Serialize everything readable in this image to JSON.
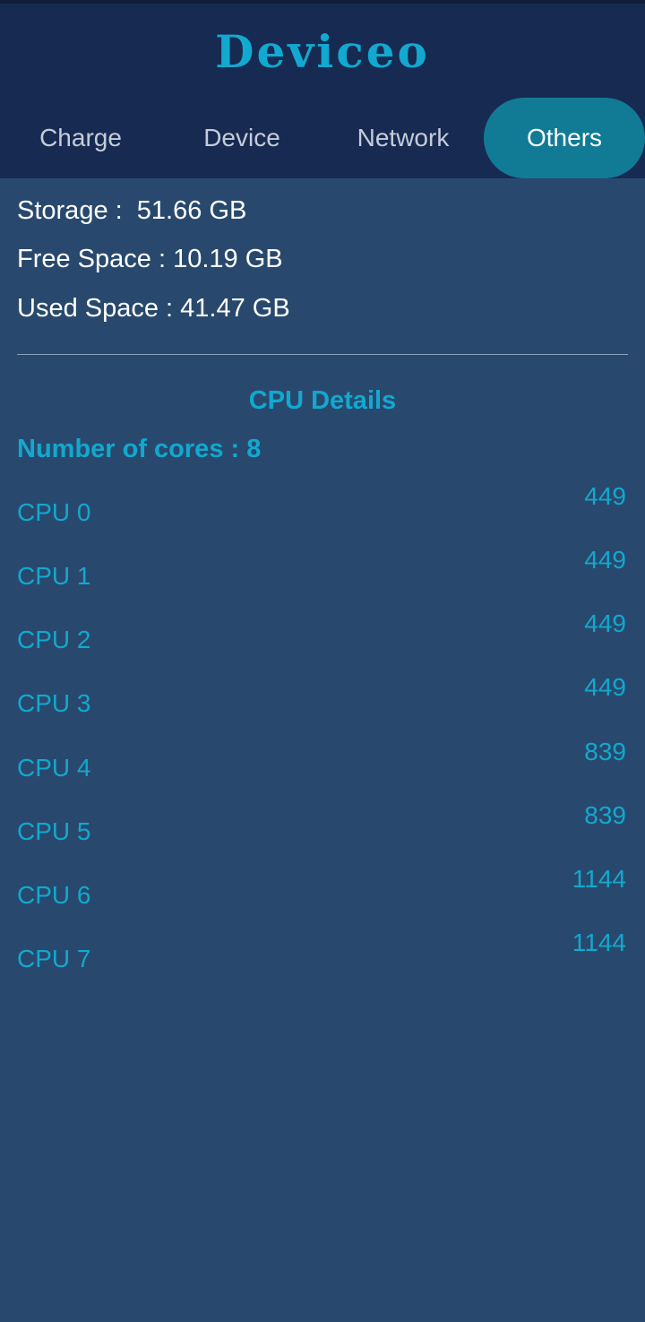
{
  "app": {
    "title": "Deviceo"
  },
  "tabs": [
    {
      "label": "Charge",
      "active": false
    },
    {
      "label": "Device",
      "active": false
    },
    {
      "label": "Network",
      "active": false
    },
    {
      "label": "Others",
      "active": true
    }
  ],
  "storage": {
    "total": "Storage :  51.66 GB",
    "free": "Free Space : 10.19 GB",
    "used": "Used Space : 41.47 GB"
  },
  "cpu": {
    "title": "CPU Details",
    "cores_text": "Number of cores : 8",
    "cores": [
      {
        "label": "CPU 0",
        "value": "449"
      },
      {
        "label": "CPU 1",
        "value": "449"
      },
      {
        "label": "CPU 2",
        "value": "449"
      },
      {
        "label": "CPU 3",
        "value": "449"
      },
      {
        "label": "CPU 4",
        "value": "839"
      },
      {
        "label": "CPU 5",
        "value": "839"
      },
      {
        "label": "CPU 6",
        "value": "1144"
      },
      {
        "label": "CPU 7",
        "value": "1144"
      }
    ]
  },
  "colors": {
    "background": "#28496d",
    "header": "#172a52",
    "accent": "#12a8d0",
    "active_tab": "#117b96"
  }
}
